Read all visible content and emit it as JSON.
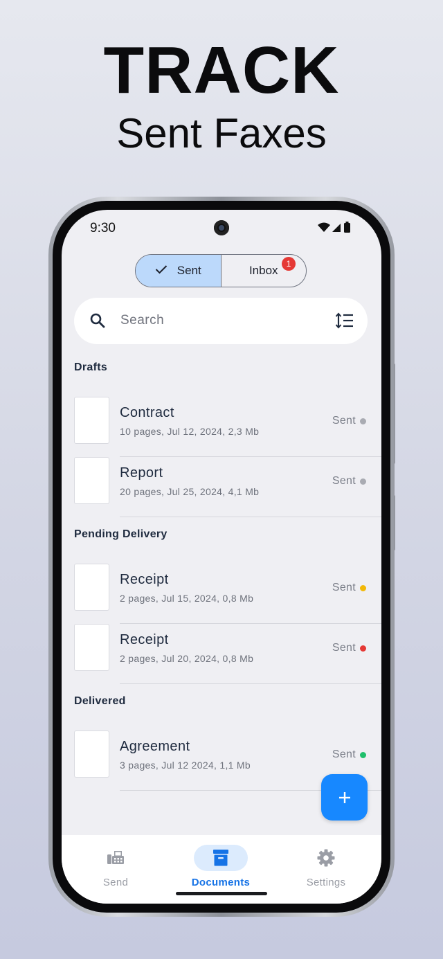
{
  "promo": {
    "headline": "TRACK",
    "subheadline": "Sent Faxes"
  },
  "status_bar": {
    "time": "9:30"
  },
  "tabs": {
    "sent_label": "Sent",
    "inbox_label": "Inbox",
    "inbox_badge": "1",
    "active": "Sent"
  },
  "search": {
    "placeholder": "Search"
  },
  "sections": [
    {
      "title": "Drafts",
      "items": [
        {
          "name": "Contract",
          "meta": "10 pages, Jul 12, 2024, 2,3 Mb",
          "status": "Sent",
          "status_color": "#a9abb2"
        },
        {
          "name": "Report",
          "meta": "20 pages, Jul 25, 2024, 4,1 Mb",
          "status": "Sent",
          "status_color": "#a9abb2"
        }
      ]
    },
    {
      "title": "Pending Delivery",
      "items": [
        {
          "name": "Receipt",
          "meta": "2 pages, Jul 15, 2024, 0,8 Mb",
          "status": "Sent",
          "status_color": "#f2b807"
        },
        {
          "name": "Receipt",
          "meta": "2 pages, Jul 20, 2024, 0,8 Mb",
          "status": "Sent",
          "status_color": "#e53935"
        }
      ]
    },
    {
      "title": "Delivered",
      "items": [
        {
          "name": "Agreement",
          "meta": "3 pages, Jul 12 2024, 1,1 Mb",
          "status": "Sent",
          "status_color": "#1fbf6b"
        }
      ]
    }
  ],
  "bottom_nav": {
    "items": [
      {
        "label": "Send",
        "icon": "fax-icon"
      },
      {
        "label": "Documents",
        "icon": "archive-box-icon",
        "active": true
      },
      {
        "label": "Settings",
        "icon": "gear-icon"
      }
    ]
  },
  "colors": {
    "accent": "#1788ff",
    "active_tab_bg": "#bcd9fb",
    "nav_active": "#1673e6"
  }
}
